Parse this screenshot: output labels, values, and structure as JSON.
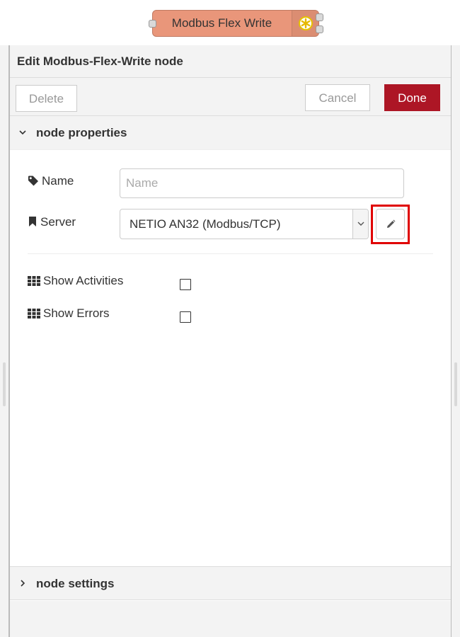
{
  "flow_node": {
    "label": "Modbus Flex Write",
    "color": "#e9967a",
    "icon": "gear-asterisk-icon"
  },
  "tray": {
    "title": "Edit Modbus-Flex-Write node",
    "toolbar": {
      "delete_label": "Delete",
      "cancel_label": "Cancel",
      "done_label": "Done",
      "done_color": "#ad1625"
    },
    "sections": {
      "properties_label": "node properties",
      "settings_label": "node settings"
    },
    "form": {
      "name_label": "Name",
      "name_placeholder": "Name",
      "name_value": "",
      "server_label": "Server",
      "server_value": "NETIO AN32 (Modbus/TCP)",
      "show_activities_label": "Show Activities",
      "show_activities_checked": false,
      "show_errors_label": "Show Errors",
      "show_errors_checked": false
    },
    "highlight_color": "#e00000"
  }
}
